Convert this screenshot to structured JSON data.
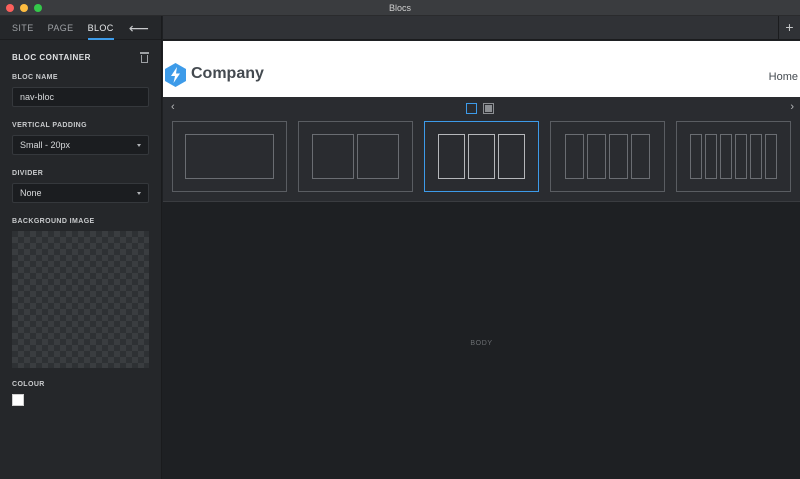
{
  "window": {
    "title": "Blocs"
  },
  "sidebar": {
    "tabs": [
      {
        "label": "SITE"
      },
      {
        "label": "PAGE"
      },
      {
        "label": "BLOC"
      }
    ],
    "section_title": "BLOC CONTAINER",
    "bloc_name": {
      "label": "BLOC NAME",
      "value": "nav-bloc"
    },
    "vertical_padding": {
      "label": "VERTICAL PADDING",
      "value": "Small - 20px"
    },
    "divider": {
      "label": "DIVIDER",
      "value": "None"
    },
    "background_image": {
      "label": "BACKGROUND IMAGE"
    },
    "colour": {
      "label": "COLOUR",
      "value": "#ffffff"
    }
  },
  "canvas": {
    "nav": {
      "brand": "Company",
      "link": "Home"
    },
    "body_label": "BODY"
  },
  "layout_options": {
    "selected_index": 2,
    "columns": [
      1,
      2,
      3,
      4,
      6
    ]
  },
  "colors": {
    "accent": "#3d9be9",
    "sidebar": "#25272a",
    "canvas": "#1e2023"
  }
}
